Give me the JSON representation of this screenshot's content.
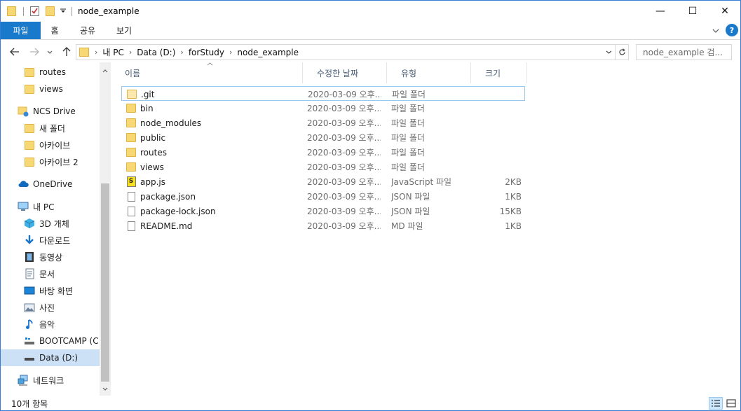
{
  "window": {
    "title": "node_example",
    "controls": {
      "minimize": "—",
      "maximize": "☐",
      "close": "✕"
    }
  },
  "ribbon": {
    "tabs": [
      {
        "label": "파일",
        "active": true
      },
      {
        "label": "홈"
      },
      {
        "label": "공유"
      },
      {
        "label": "보기"
      }
    ],
    "expand_icon": "chevron-down-icon"
  },
  "address": {
    "breadcrumb": [
      "내 PC",
      "Data (D:)",
      "forStudy",
      "node_example"
    ],
    "search_placeholder": "node_example 검..."
  },
  "navpane": {
    "items": [
      {
        "label": "routes",
        "icon": "folder-icon"
      },
      {
        "label": "views",
        "icon": "folder-icon"
      },
      {
        "label": "NCS Drive",
        "icon": "network-drive-icon"
      },
      {
        "label": "새 폴더",
        "icon": "folder-icon"
      },
      {
        "label": "아카이브",
        "icon": "folder-icon"
      },
      {
        "label": "아카이브 2",
        "icon": "folder-icon"
      },
      {
        "label": "OneDrive",
        "icon": "onedrive-icon"
      },
      {
        "label": "내 PC",
        "icon": "pc-icon"
      },
      {
        "label": "3D 개체",
        "icon": "3d-objects-icon"
      },
      {
        "label": "다운로드",
        "icon": "download-icon"
      },
      {
        "label": "동영상",
        "icon": "video-icon"
      },
      {
        "label": "문서",
        "icon": "document-icon"
      },
      {
        "label": "바탕 화면",
        "icon": "desktop-icon"
      },
      {
        "label": "사진",
        "icon": "pictures-icon"
      },
      {
        "label": "음악",
        "icon": "music-icon"
      },
      {
        "label": "BOOTCAMP (C:",
        "icon": "drive-icon"
      },
      {
        "label": "Data (D:)",
        "icon": "drive-icon",
        "selected": true
      },
      {
        "label": "네트워크",
        "icon": "network-icon"
      }
    ]
  },
  "filelist": {
    "columns": {
      "name": "이름",
      "modified": "수정한 날짜",
      "type": "유형",
      "size": "크기"
    },
    "rows": [
      {
        "name": ".git",
        "modified": "2020-03-09 오후...",
        "type": "파일 폴더",
        "size": "",
        "icon": "folder-icon"
      },
      {
        "name": "bin",
        "modified": "2020-03-09 오후...",
        "type": "파일 폴더",
        "size": "",
        "icon": "folder-icon"
      },
      {
        "name": "node_modules",
        "modified": "2020-03-09 오후...",
        "type": "파일 폴더",
        "size": "",
        "icon": "folder-icon"
      },
      {
        "name": "public",
        "modified": "2020-03-09 오후...",
        "type": "파일 폴더",
        "size": "",
        "icon": "folder-icon"
      },
      {
        "name": "routes",
        "modified": "2020-03-09 오후...",
        "type": "파일 폴더",
        "size": "",
        "icon": "folder-icon"
      },
      {
        "name": "views",
        "modified": "2020-03-09 오후...",
        "type": "파일 폴더",
        "size": "",
        "icon": "folder-icon"
      },
      {
        "name": "app.js",
        "modified": "2020-03-09 오후...",
        "type": "JavaScript 파일",
        "size": "2KB",
        "icon": "javascript-file-icon"
      },
      {
        "name": "package.json",
        "modified": "2020-03-09 오후...",
        "type": "JSON 파일",
        "size": "1KB",
        "icon": "file-icon"
      },
      {
        "name": "package-lock.json",
        "modified": "2020-03-09 오후...",
        "type": "JSON 파일",
        "size": "15KB",
        "icon": "file-icon"
      },
      {
        "name": "README.md",
        "modified": "2020-03-09 오후...",
        "type": "MD 파일",
        "size": "1KB",
        "icon": "file-icon"
      }
    ]
  },
  "status": {
    "item_count": "10개 항목"
  },
  "colors": {
    "accent": "#1979ca",
    "folder": "#f8d775",
    "selection": "#cce1f5",
    "focus_border": "#99c9ef"
  }
}
